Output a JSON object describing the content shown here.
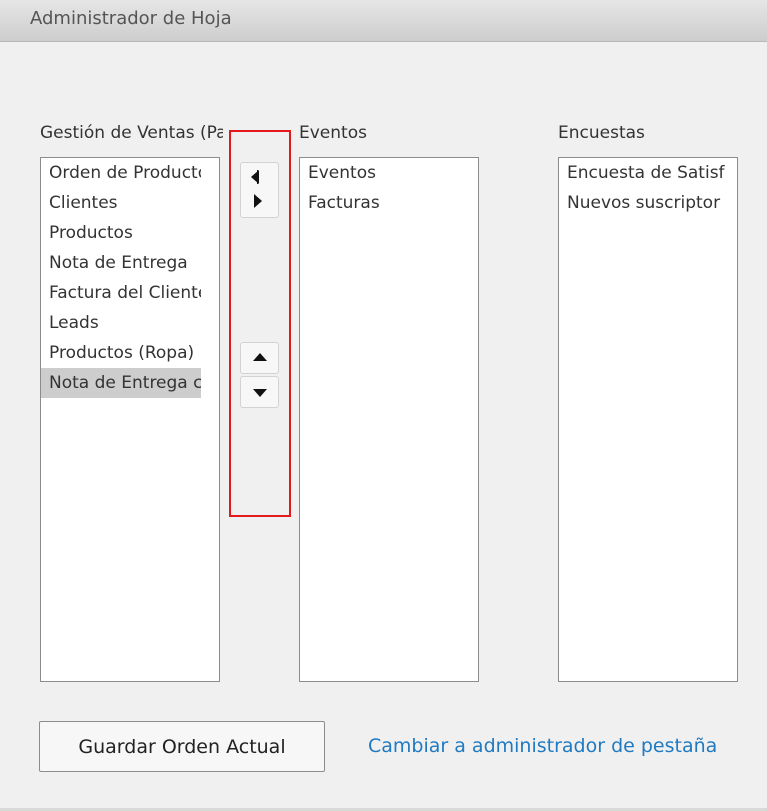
{
  "window": {
    "title": "Administrador de Hoja"
  },
  "columns": [
    {
      "header": "Gestión de Ventas (Pa",
      "items": [
        {
          "label": "Orden de Producto"
        },
        {
          "label": "Clientes"
        },
        {
          "label": "Productos"
        },
        {
          "label": "Nota de Entrega"
        },
        {
          "label": "Factura del Cliente"
        },
        {
          "label": "Leads"
        },
        {
          "label": "Productos (Ropa)"
        },
        {
          "label": "Nota de Entrega co",
          "selected": true
        }
      ]
    },
    {
      "header": "Eventos",
      "items": [
        {
          "label": "Eventos"
        },
        {
          "label": "Facturas"
        }
      ]
    },
    {
      "header": "Encuestas",
      "items": [
        {
          "label": "Encuesta de Satisf"
        },
        {
          "label": "Nuevos suscriptor"
        }
      ]
    }
  ],
  "controls": {
    "move_left_icon": "triangle-left-icon",
    "move_right_icon": "triangle-right-icon",
    "move_up_icon": "triangle-up-icon",
    "move_down_icon": "triangle-down-icon"
  },
  "footer": {
    "save_label": "Guardar Orden Actual",
    "switch_link_label": "Cambiar a administrador de pestaña"
  },
  "colors": {
    "highlight": "#e3191c",
    "link": "#1f7ac2",
    "selected_row": "#cdcdcd"
  }
}
